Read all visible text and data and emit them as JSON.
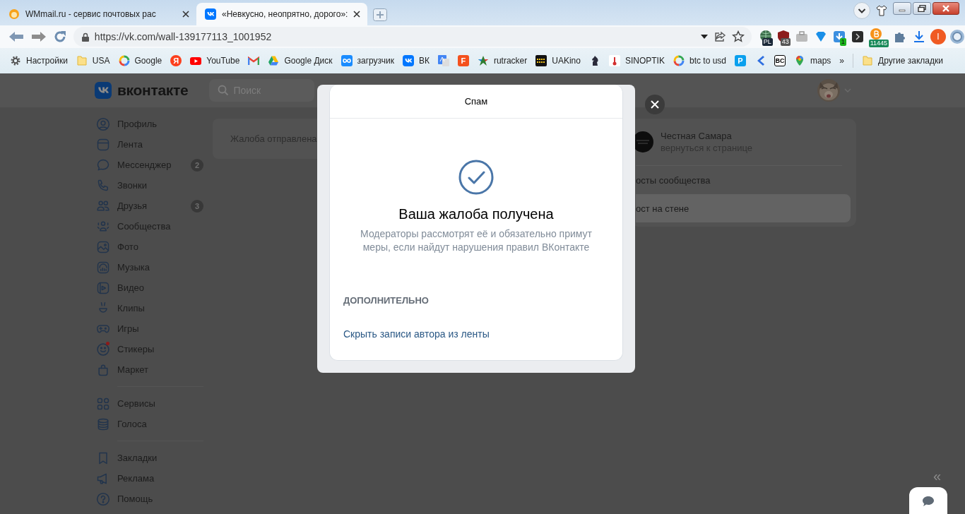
{
  "browser": {
    "tabs": [
      {
        "title": "WMmail.ru - сервис почтовых рас",
        "selected": false
      },
      {
        "title": "«Невкусно, неопрятно, дорого»:",
        "selected": true
      }
    ],
    "url": "https://vk.com/wall-139177113_1001952",
    "extension_badges": [
      "PL",
      "43",
      "1",
      "11445"
    ],
    "profile_initial": "I",
    "bookmarks": [
      {
        "kind": "labeled",
        "label": "Настройки"
      },
      {
        "kind": "labeled",
        "label": "USA"
      },
      {
        "kind": "labeled",
        "label": "Google"
      },
      {
        "kind": "icon",
        "icon_text": "Я"
      },
      {
        "kind": "labeled",
        "label": "YouTube"
      },
      {
        "kind": "icon"
      },
      {
        "kind": "labeled",
        "label": "Google Диск"
      },
      {
        "kind": "labeled",
        "label": "загрузчик"
      },
      {
        "kind": "labeled",
        "label": "ВК"
      },
      {
        "kind": "icon"
      },
      {
        "kind": "icon",
        "icon_text": "F"
      },
      {
        "kind": "labeled",
        "label": "rutracker"
      },
      {
        "kind": "labeled",
        "label": "UAKino"
      },
      {
        "kind": "icon"
      },
      {
        "kind": "labeled",
        "label": "SINOPTIK"
      },
      {
        "kind": "labeled",
        "label": "btc to usd"
      },
      {
        "kind": "icon",
        "icon_text": "P"
      },
      {
        "kind": "icon"
      },
      {
        "kind": "icon",
        "icon_text": "BC"
      },
      {
        "kind": "labeled",
        "label": "maps"
      }
    ],
    "bookmarks_more": "»",
    "other_bookmarks": "Другие закладки"
  },
  "vk": {
    "logo": "вконтакте",
    "search": {
      "placeholder": "Поиск"
    },
    "sidebar": {
      "sections": [
        {
          "items": [
            {
              "label": "Профиль",
              "notification": false
            },
            {
              "label": "Лента",
              "notification": false
            },
            {
              "label": "Мессенджер",
              "badge": "2",
              "notification": false
            },
            {
              "label": "Звонки",
              "notification": false
            },
            {
              "label": "Друзья",
              "badge": "3",
              "notification": false
            },
            {
              "label": "Сообщества",
              "notification": false
            },
            {
              "label": "Фото",
              "notification": false
            },
            {
              "label": "Музыка",
              "notification": false
            },
            {
              "label": "Видео",
              "notification": false
            },
            {
              "label": "Клипы",
              "notification": false
            },
            {
              "label": "Игры",
              "notification": false
            },
            {
              "label": "Стикеры",
              "notification": true
            },
            {
              "label": "Маркет",
              "notification": false
            }
          ]
        },
        {
          "items": [
            {
              "label": "Сервисы",
              "notification": false
            },
            {
              "label": "Голоса",
              "notification": false
            }
          ]
        },
        {
          "items": [
            {
              "label": "Закладки",
              "notification": false
            },
            {
              "label": "Реклама",
              "notification": false
            },
            {
              "label": "Помощь",
              "notification": false
            }
          ]
        }
      ]
    },
    "complaint_notice": "Жалоба отправлена",
    "community": {
      "name": "Честная Самара",
      "link": "вернуться к странице",
      "menu": [
        {
          "label": "осты сообщества",
          "selected": false
        },
        {
          "label": "ост на стене",
          "selected": true
        }
      ]
    },
    "collapse": "«"
  },
  "modal": {
    "title": "Спам",
    "heading": "Ваша жалоба получена",
    "message": "Модераторы рассмотрят её и обязательно примут\nмеры, если найдут нарушения правил ВКонтакте",
    "section": "ДОПОЛНИТЕЛЬНО",
    "link": "Скрыть записи автора из ленты"
  }
}
